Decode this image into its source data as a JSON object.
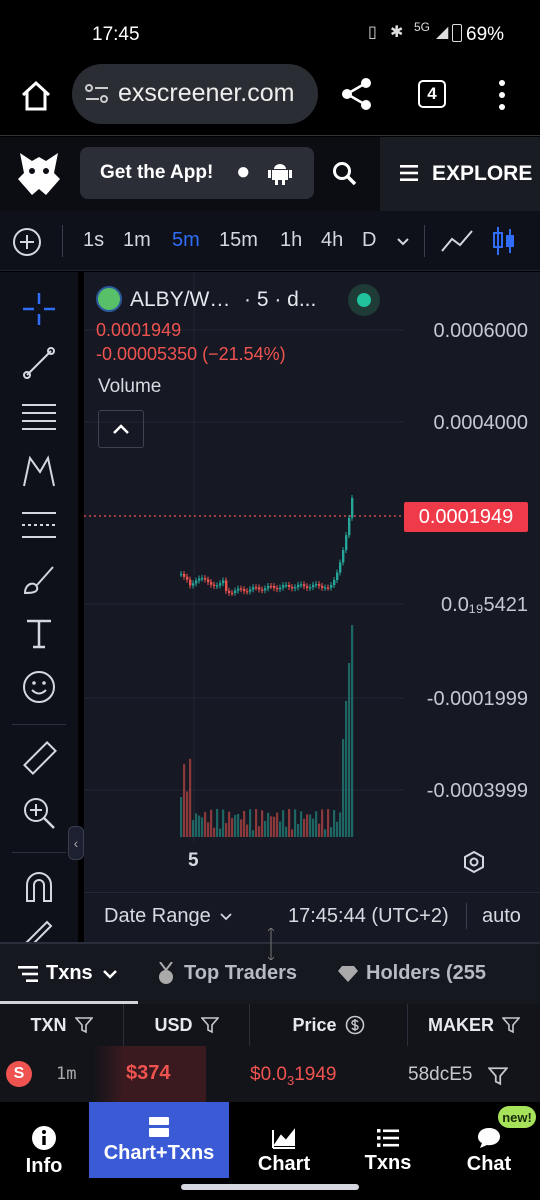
{
  "status": {
    "time": "17:45",
    "battery": "69%",
    "network": "5G"
  },
  "browser": {
    "url": "exscreener.com",
    "tab_count": "4"
  },
  "appbar": {
    "get_app": "Get the App!",
    "explore": "EXPLORE"
  },
  "timeframes": [
    "1s",
    "1m",
    "5m",
    "15m",
    "1h",
    "4h",
    "D"
  ],
  "active_timeframe": "5m",
  "chart": {
    "pair": "ALBY/W…",
    "interval": "· 5 · d...",
    "price": "0.0001949",
    "change": "-0.00005350 (−21.54%)",
    "volume_label": "Volume",
    "y_labels": [
      "0.0006000",
      "0.0004000",
      "0.0001949",
      "0.0₁₉5421",
      "-0.0001999",
      "-0.0003999"
    ],
    "x_label": "5",
    "date_range": "Date Range",
    "clock": "17:45:44 (UTC+2)",
    "scale_mode": "auto",
    "accent_up": "#26a69a",
    "accent_down": "#ef5350"
  },
  "tabs": {
    "txns": "Txns",
    "top_traders": "Top Traders",
    "holders": "Holders (255"
  },
  "table": {
    "headers": [
      "TXN",
      "USD",
      "Price",
      "MAKER"
    ],
    "row": {
      "type": "S",
      "age": "1m",
      "usd": "$374",
      "price_prefix": "$0.0",
      "price_sub": "3",
      "price_rest": "1949",
      "maker": "58dcE5"
    }
  },
  "nav": {
    "info": "Info",
    "chart_txns": "Chart+Txns",
    "chart": "Chart",
    "txns": "Txns",
    "chat": "Chat",
    "badge": "new!"
  }
}
